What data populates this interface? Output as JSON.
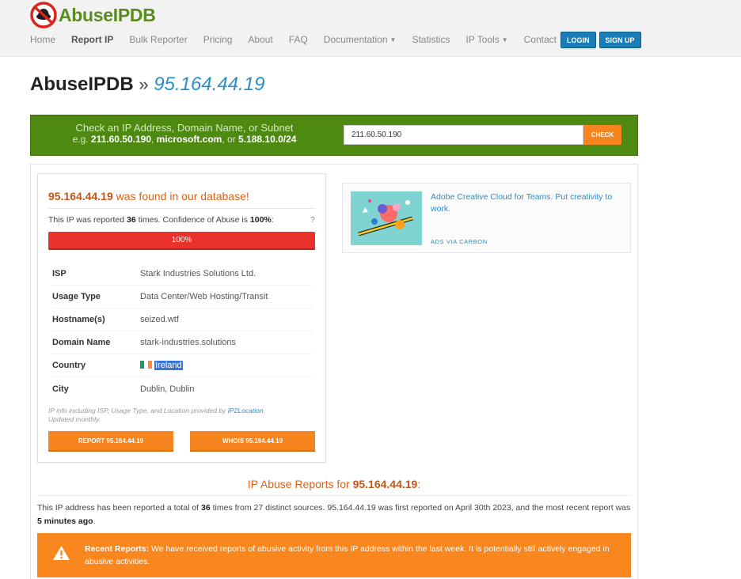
{
  "brand": {
    "name": "AbuseIPDB"
  },
  "nav": {
    "items": [
      {
        "label": "Home",
        "active": false
      },
      {
        "label": "Report IP",
        "active": true
      },
      {
        "label": "Bulk Reporter",
        "active": false
      },
      {
        "label": "Pricing",
        "active": false
      },
      {
        "label": "About",
        "active": false
      },
      {
        "label": "FAQ",
        "active": false
      },
      {
        "label": "Documentation",
        "active": false,
        "dropdown": true
      },
      {
        "label": "Statistics",
        "active": false
      },
      {
        "label": "IP Tools",
        "active": false,
        "dropdown": true
      },
      {
        "label": "Contact",
        "active": false
      }
    ],
    "login": "LOGIN",
    "signup": "SIGN UP"
  },
  "title": {
    "site": "AbuseIPDB",
    "separator": "»",
    "ip": "95.164.44.19"
  },
  "check": {
    "line1": "Check an IP Address, Domain Name, or Subnet",
    "line2_prefix": "e.g. ",
    "ex1": "211.60.50.190",
    "ex_sep1": ", ",
    "ex2": "microsoft.com",
    "ex_sep2": ", or ",
    "ex3": "5.188.10.0/24",
    "input_value": "211.60.50.190",
    "button": "CHECK"
  },
  "result": {
    "ip": "95.164.44.19",
    "found_suffix": " was found in our database!",
    "reported_prefix": "This IP was reported ",
    "times": "36",
    "reported_mid": " times. Confidence of Abuse is ",
    "confidence": "100%",
    "reported_suffix": ":",
    "help": "?",
    "confidence_fraction": 1.0,
    "bar_label": "100%",
    "details": [
      {
        "label": "ISP",
        "value": "Stark Industries Solutions Ltd."
      },
      {
        "label": "Usage Type",
        "value": "Data Center/Web Hosting/Transit"
      },
      {
        "label": "Hostname(s)",
        "value": "seized.wtf"
      },
      {
        "label": "Domain Name",
        "value": "stark-industries.solutions"
      },
      {
        "label": "Country",
        "value": "Ireland"
      },
      {
        "label": "City",
        "value": "Dublin, Dublin"
      }
    ],
    "provided_prefix": "IP info including ISP, Usage Type, and Location provided by ",
    "provided_link": "IP2Location",
    "provided_suffix": ".",
    "updated": "Updated monthly.",
    "report_btn": "REPORT 95.164.44.19",
    "whois_btn": "WHOIS 95.164.44.19"
  },
  "ad": {
    "title": "Adobe Creative Cloud for Teams. Put creativity to work.",
    "via": "ADS VIA CARBON"
  },
  "reports": {
    "heading_prefix": "IP Abuse Reports for ",
    "heading_ip": "95.164.44.19",
    "heading_suffix": ":",
    "text_a": "This IP address has been reported a total of ",
    "total": "36",
    "text_b": " times from 27 distinct sources. 95.164.44.19 was first reported on April 30th 2023, and the most recent report was ",
    "recent": "5 minutes ago",
    "text_c": ".",
    "alert_title": "Recent Reports:",
    "alert_text": " We have received reports of abusive activity from this IP address within the last week. It is potentially still actively engaged in abusive activities."
  },
  "colors": {
    "brand_green": "#5b8a1f",
    "check_bar": "#4e8a12",
    "accent_orange": "#f6851f",
    "danger_red": "#e8322b",
    "link_blue": "#2a8fc7",
    "login_blue": "#1a7db5"
  }
}
